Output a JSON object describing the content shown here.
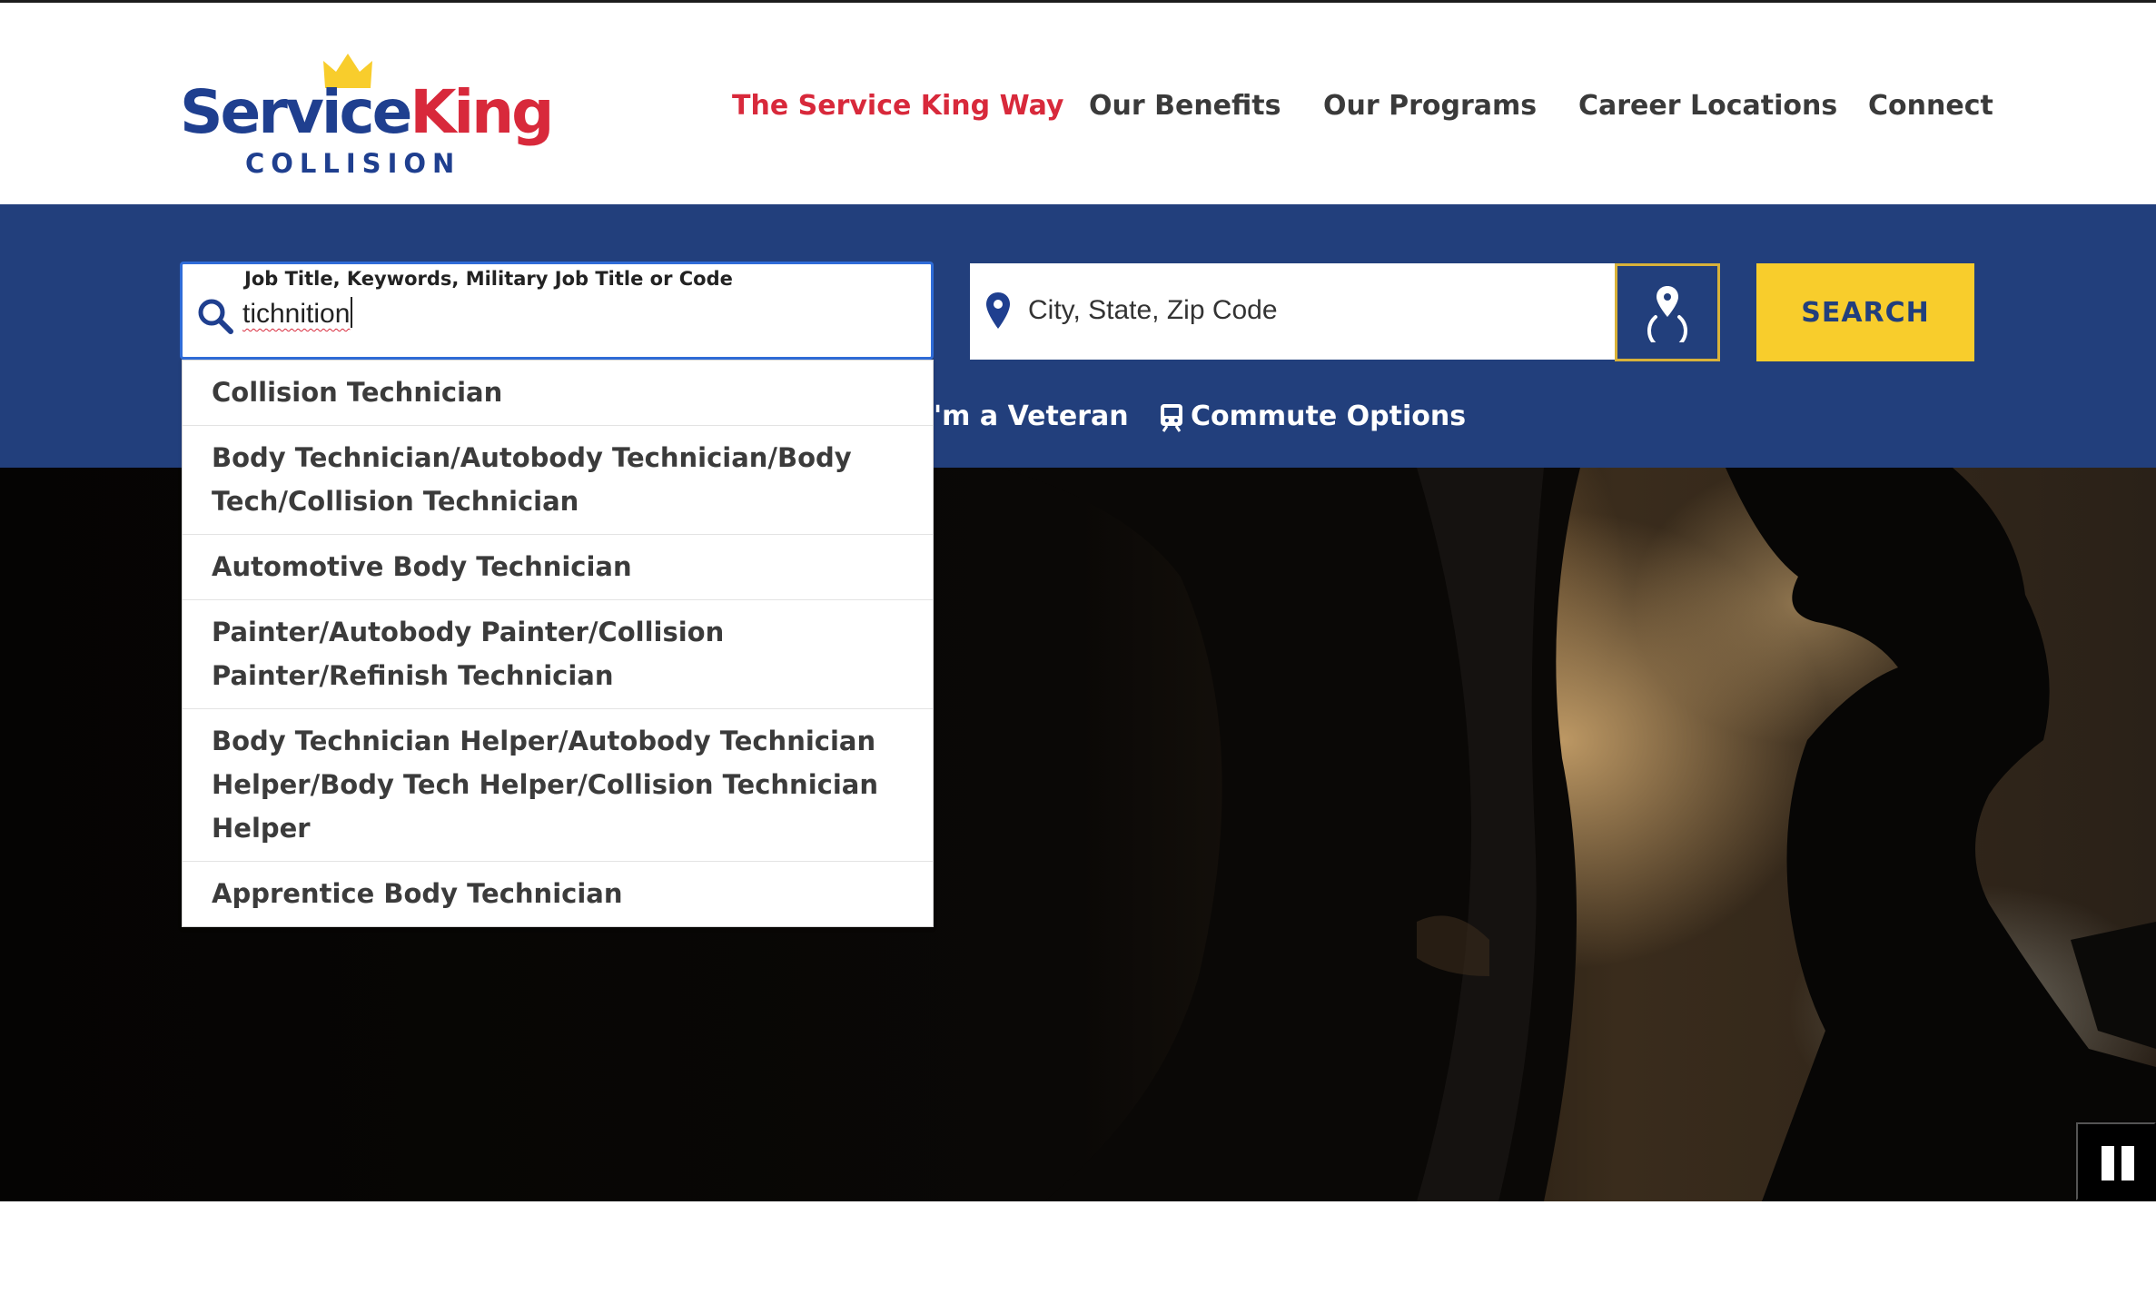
{
  "brand": {
    "name_part1": "Service",
    "name_part2": "King",
    "sub": "COLLISION",
    "colors": {
      "navy": "#223f7c",
      "red": "#d8293b",
      "yellow": "#f8cd2c"
    }
  },
  "nav": {
    "items": [
      {
        "label": "The Service King Way",
        "active": true
      },
      {
        "label": "Our Benefits"
      },
      {
        "label": "Our Programs"
      },
      {
        "label": "Career Locations"
      },
      {
        "label": "Connect"
      }
    ]
  },
  "search": {
    "keyword_label": "Job Title, Keywords, Military Job Title or Code",
    "keyword_value": "tichnition",
    "location_placeholder": "City, State, Zip Code",
    "search_label": "SEARCH",
    "icons": {
      "keyword": "search-icon",
      "location": "map-pin-icon",
      "geolocate": "geolocate-icon"
    }
  },
  "links": {
    "veteran": "'m a Veteran",
    "commute": "Commute Options"
  },
  "suggestions": [
    "Collision Technician",
    "Body Technician/Autobody Technician/Body Tech/Collision Technician",
    "Automotive Body Technician",
    "Painter/Autobody Painter/Collision Painter/Refinish Technician",
    "Body Technician Helper/Autobody Technician Helper/Body Tech Helper/Collision Technician Helper",
    "Apprentice Body Technician"
  ],
  "video": {
    "control_icon": "pause-icon"
  }
}
